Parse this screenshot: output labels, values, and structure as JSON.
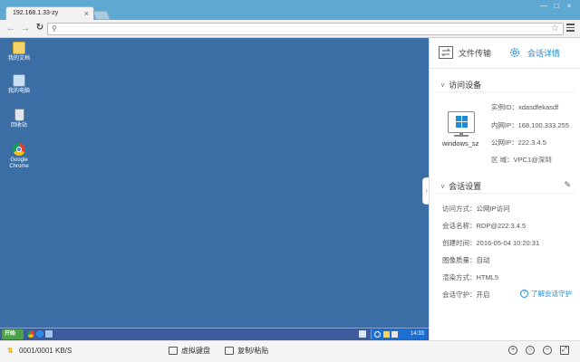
{
  "browser": {
    "tab_title": "192.168.1.33-zy",
    "tab_close": "×",
    "window_buttons": [
      "—",
      "□",
      "×"
    ],
    "accent_color": "#5ea8d2"
  },
  "desktop": {
    "background_color": "#3b6ea5",
    "icons": [
      {
        "label": "我的文档",
        "icon": "documents-folder-icon"
      },
      {
        "label": "我的电脑",
        "icon": "computer-icon"
      },
      {
        "label": "回收站",
        "icon": "recycle-bin-icon"
      },
      {
        "label": "Google Chrome",
        "icon": "chrome-icon"
      }
    ],
    "taskbar": {
      "start_label": "开始",
      "clock": "14:33"
    }
  },
  "statusbar": {
    "speed": "0001/0001 KB/S",
    "virtual_keyboard": "虚拟键盘",
    "copy_paste": "复制/粘贴",
    "zoom_in": "+",
    "zoom_reset": "○",
    "zoom_out": "−",
    "fullscreen": "⤢"
  },
  "panel": {
    "tabs": {
      "file_transfer": "文件传输",
      "session_details": "会话详情"
    },
    "accent_color": "#1f8ad6",
    "device_section": {
      "title": "访问设备",
      "os_name": "windows_sz",
      "instance_id": "实例ID：xdasdfekasdf",
      "private_ip": "内网IP：168.100.333.255",
      "public_ip": "公网IP：222.3.4.5",
      "region": "区  域：VPC1@深圳"
    },
    "session_section": {
      "title": "会话设置",
      "access_method": "访问方式：公网IP访问",
      "session_name": "会话名称：RDP@222.3.4.5",
      "created_time": "创建时间：2016-05-04 10:20:31",
      "image_quality": "图像质量：自动",
      "render_mode": "渲染方式：HTML5",
      "session_guard": "会话守护：开启",
      "help_link": "了解会话守护"
    }
  }
}
